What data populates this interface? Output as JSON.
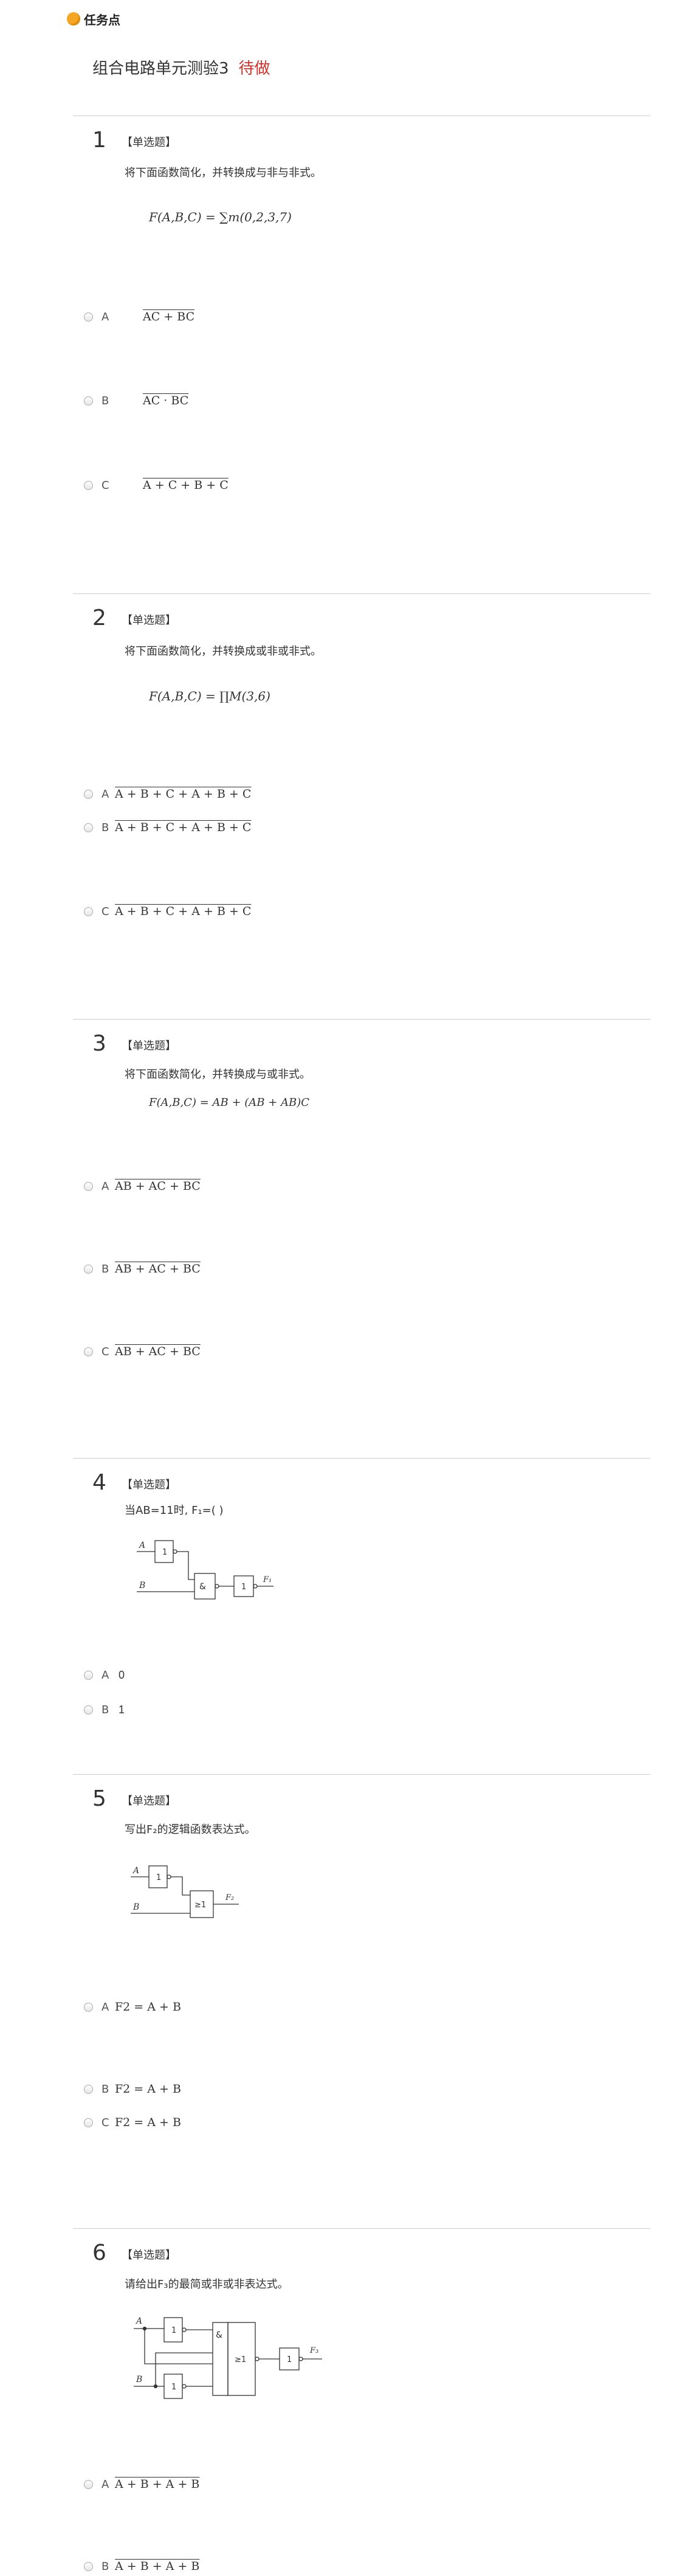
{
  "header": {
    "title": "任务点"
  },
  "test": {
    "title": "组合电路单元测验3",
    "status": "待做"
  },
  "questions": [
    {
      "num": "1",
      "type": "【单选题】",
      "text": "将下面函数简化，并转换成与非与非式。",
      "formula": "F(A,B,C) = ∑m(0,2,3,7)",
      "options": [
        {
          "letter": "A",
          "value": "AC + BC"
        },
        {
          "letter": "B",
          "value": "AC · BC"
        },
        {
          "letter": "C",
          "value": "A + C + B + C"
        }
      ]
    },
    {
      "num": "2",
      "type": "【单选题】",
      "text": "将下面函数简化，并转换成或非或非式。",
      "formula": "F(A,B,C) = ∏M(3,6)",
      "options": [
        {
          "letter": "A",
          "value": "A + B + C + A + B + C"
        },
        {
          "letter": "B",
          "value": "A + B + C + A + B + C"
        },
        {
          "letter": "C",
          "value": "A + B + C + A + B + C"
        }
      ]
    },
    {
      "num": "3",
      "type": "【单选题】",
      "text": "将下面函数简化，并转换成与或非式。",
      "formula": "F(A,B,C) = AB + (AB + AB)C",
      "options": [
        {
          "letter": "A",
          "value": "AB + AC + BC"
        },
        {
          "letter": "B",
          "value": "AB + AC + BC"
        },
        {
          "letter": "C",
          "value": "AB + AC + BC"
        }
      ]
    },
    {
      "num": "4",
      "type": "【单选题】",
      "text": "当AB=11时, F₁=(     )",
      "options": [
        {
          "letter": "A",
          "value": "0"
        },
        {
          "letter": "B",
          "value": "1"
        }
      ],
      "circuit": {
        "a": "A",
        "b": "B",
        "out": "F₁",
        "g1": "1",
        "g2": "&",
        "g3": "1"
      }
    },
    {
      "num": "5",
      "type": "【单选题】",
      "text": "写出F₂的逻辑函数表达式。",
      "options": [
        {
          "letter": "A",
          "value": "F2 = A + B"
        },
        {
          "letter": "B",
          "value": "F2 = A + B"
        },
        {
          "letter": "C",
          "value": "F2 = A + B"
        }
      ],
      "circuit": {
        "a": "A",
        "b": "B",
        "out": "F₂",
        "g1": "1",
        "g2": "≥1"
      }
    },
    {
      "num": "6",
      "type": "【单选题】",
      "text": "请给出F₃的最简或非或非表达式。",
      "options": [
        {
          "letter": "A",
          "value": "A + B + A + B"
        },
        {
          "letter": "B",
          "value": "A + B + A + B"
        }
      ],
      "circuit": {
        "a": "A",
        "b": "B",
        "out": "F₃",
        "g1": "1",
        "g2": "1",
        "g3": "&",
        "g4": "≥1",
        "g5": "1"
      }
    }
  ]
}
